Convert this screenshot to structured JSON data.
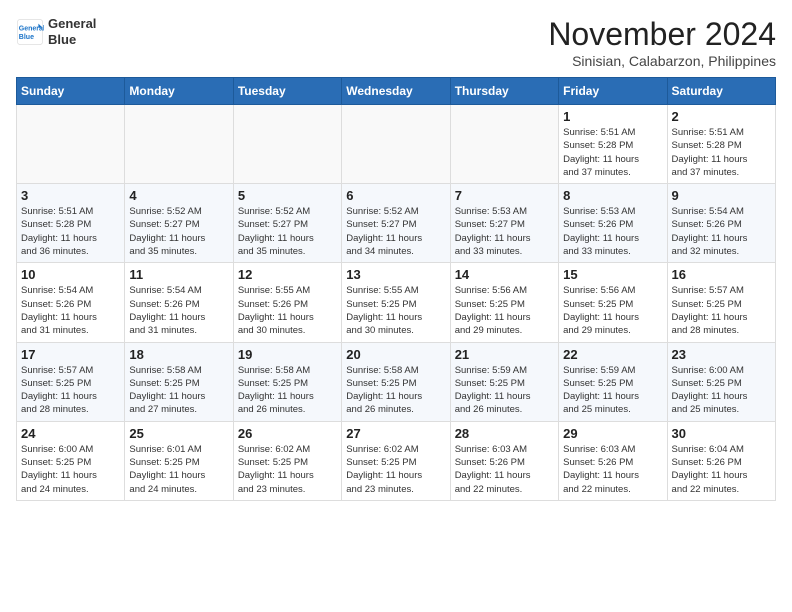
{
  "header": {
    "logo_line1": "General",
    "logo_line2": "Blue",
    "month": "November 2024",
    "location": "Sinisian, Calabarzon, Philippines"
  },
  "weekdays": [
    "Sunday",
    "Monday",
    "Tuesday",
    "Wednesday",
    "Thursday",
    "Friday",
    "Saturday"
  ],
  "weeks": [
    [
      {
        "day": "",
        "info": ""
      },
      {
        "day": "",
        "info": ""
      },
      {
        "day": "",
        "info": ""
      },
      {
        "day": "",
        "info": ""
      },
      {
        "day": "",
        "info": ""
      },
      {
        "day": "1",
        "info": "Sunrise: 5:51 AM\nSunset: 5:28 PM\nDaylight: 11 hours\nand 37 minutes."
      },
      {
        "day": "2",
        "info": "Sunrise: 5:51 AM\nSunset: 5:28 PM\nDaylight: 11 hours\nand 37 minutes."
      }
    ],
    [
      {
        "day": "3",
        "info": "Sunrise: 5:51 AM\nSunset: 5:28 PM\nDaylight: 11 hours\nand 36 minutes."
      },
      {
        "day": "4",
        "info": "Sunrise: 5:52 AM\nSunset: 5:27 PM\nDaylight: 11 hours\nand 35 minutes."
      },
      {
        "day": "5",
        "info": "Sunrise: 5:52 AM\nSunset: 5:27 PM\nDaylight: 11 hours\nand 35 minutes."
      },
      {
        "day": "6",
        "info": "Sunrise: 5:52 AM\nSunset: 5:27 PM\nDaylight: 11 hours\nand 34 minutes."
      },
      {
        "day": "7",
        "info": "Sunrise: 5:53 AM\nSunset: 5:27 PM\nDaylight: 11 hours\nand 33 minutes."
      },
      {
        "day": "8",
        "info": "Sunrise: 5:53 AM\nSunset: 5:26 PM\nDaylight: 11 hours\nand 33 minutes."
      },
      {
        "day": "9",
        "info": "Sunrise: 5:54 AM\nSunset: 5:26 PM\nDaylight: 11 hours\nand 32 minutes."
      }
    ],
    [
      {
        "day": "10",
        "info": "Sunrise: 5:54 AM\nSunset: 5:26 PM\nDaylight: 11 hours\nand 31 minutes."
      },
      {
        "day": "11",
        "info": "Sunrise: 5:54 AM\nSunset: 5:26 PM\nDaylight: 11 hours\nand 31 minutes."
      },
      {
        "day": "12",
        "info": "Sunrise: 5:55 AM\nSunset: 5:26 PM\nDaylight: 11 hours\nand 30 minutes."
      },
      {
        "day": "13",
        "info": "Sunrise: 5:55 AM\nSunset: 5:25 PM\nDaylight: 11 hours\nand 30 minutes."
      },
      {
        "day": "14",
        "info": "Sunrise: 5:56 AM\nSunset: 5:25 PM\nDaylight: 11 hours\nand 29 minutes."
      },
      {
        "day": "15",
        "info": "Sunrise: 5:56 AM\nSunset: 5:25 PM\nDaylight: 11 hours\nand 29 minutes."
      },
      {
        "day": "16",
        "info": "Sunrise: 5:57 AM\nSunset: 5:25 PM\nDaylight: 11 hours\nand 28 minutes."
      }
    ],
    [
      {
        "day": "17",
        "info": "Sunrise: 5:57 AM\nSunset: 5:25 PM\nDaylight: 11 hours\nand 28 minutes."
      },
      {
        "day": "18",
        "info": "Sunrise: 5:58 AM\nSunset: 5:25 PM\nDaylight: 11 hours\nand 27 minutes."
      },
      {
        "day": "19",
        "info": "Sunrise: 5:58 AM\nSunset: 5:25 PM\nDaylight: 11 hours\nand 26 minutes."
      },
      {
        "day": "20",
        "info": "Sunrise: 5:58 AM\nSunset: 5:25 PM\nDaylight: 11 hours\nand 26 minutes."
      },
      {
        "day": "21",
        "info": "Sunrise: 5:59 AM\nSunset: 5:25 PM\nDaylight: 11 hours\nand 26 minutes."
      },
      {
        "day": "22",
        "info": "Sunrise: 5:59 AM\nSunset: 5:25 PM\nDaylight: 11 hours\nand 25 minutes."
      },
      {
        "day": "23",
        "info": "Sunrise: 6:00 AM\nSunset: 5:25 PM\nDaylight: 11 hours\nand 25 minutes."
      }
    ],
    [
      {
        "day": "24",
        "info": "Sunrise: 6:00 AM\nSunset: 5:25 PM\nDaylight: 11 hours\nand 24 minutes."
      },
      {
        "day": "25",
        "info": "Sunrise: 6:01 AM\nSunset: 5:25 PM\nDaylight: 11 hours\nand 24 minutes."
      },
      {
        "day": "26",
        "info": "Sunrise: 6:02 AM\nSunset: 5:25 PM\nDaylight: 11 hours\nand 23 minutes."
      },
      {
        "day": "27",
        "info": "Sunrise: 6:02 AM\nSunset: 5:25 PM\nDaylight: 11 hours\nand 23 minutes."
      },
      {
        "day": "28",
        "info": "Sunrise: 6:03 AM\nSunset: 5:26 PM\nDaylight: 11 hours\nand 22 minutes."
      },
      {
        "day": "29",
        "info": "Sunrise: 6:03 AM\nSunset: 5:26 PM\nDaylight: 11 hours\nand 22 minutes."
      },
      {
        "day": "30",
        "info": "Sunrise: 6:04 AM\nSunset: 5:26 PM\nDaylight: 11 hours\nand 22 minutes."
      }
    ]
  ]
}
